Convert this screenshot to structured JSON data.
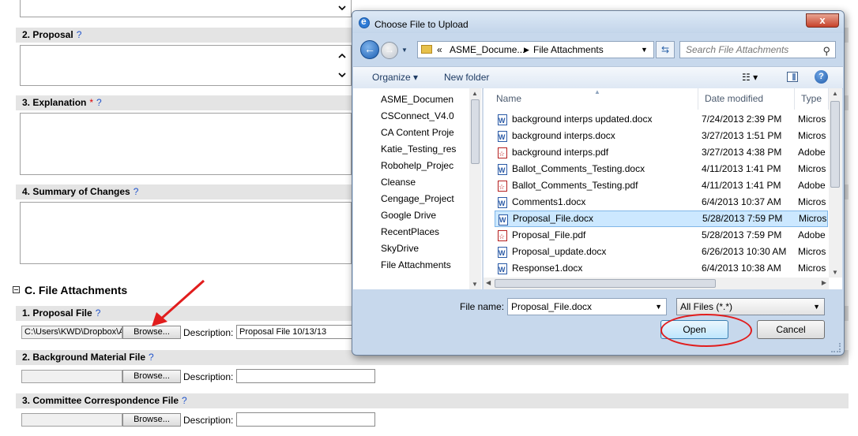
{
  "form": {
    "sections": [
      {
        "number_title": "2. Proposal",
        "required": "",
        "help": "?"
      },
      {
        "number_title": "3. Explanation",
        "required": "*",
        "help": "?"
      },
      {
        "number_title": "4. Summary of Changes",
        "help": "?"
      }
    ],
    "group_title": "C. File Attachments",
    "attachments": [
      {
        "number_title": "1. Proposal File",
        "help": "?",
        "file_path": "C:\\Users\\KWD\\Dropbox\\A",
        "browse_label": "Browse...",
        "desc_label": "Description:",
        "desc_value": "Proposal File 10/13/13"
      },
      {
        "number_title": "2. Background Material File",
        "help": "?",
        "file_path": "",
        "browse_label": "Browse...",
        "desc_label": "Description:",
        "desc_value": ""
      },
      {
        "number_title": "3. Committee Correspondence File",
        "help": "?",
        "file_path": "",
        "browse_label": "Browse...",
        "desc_label": "Description:",
        "desc_value": ""
      }
    ]
  },
  "dialog": {
    "title": "Choose File to Upload",
    "close_glyph": "x",
    "address": {
      "chevrons": "«",
      "crumbs": [
        "ASME_Docume...",
        "File Attachments"
      ],
      "separator": "▶"
    },
    "search_placeholder": "Search File Attachments",
    "toolbar": {
      "organize": "Organize ▾",
      "new_folder": "New folder",
      "view_glyph": "☷ ▾",
      "help": "?"
    },
    "nav_items": [
      {
        "label": "ASME_Documen",
        "icon": "folder-icon"
      },
      {
        "label": "CSConnect_V4.0",
        "icon": "folder-icon"
      },
      {
        "label": "CA Content Proje",
        "icon": "folder-icon"
      },
      {
        "label": "Katie_Testing_res",
        "icon": "folder-icon"
      },
      {
        "label": "Robohelp_Projec",
        "icon": "folder-icon"
      },
      {
        "label": "Cleanse",
        "icon": "folder-icon"
      },
      {
        "label": "Cengage_Project",
        "icon": "folder-icon"
      },
      {
        "label": "Google Drive",
        "icon": "google-drive-icon"
      },
      {
        "label": "RecentPlaces",
        "icon": "recent-places-icon"
      },
      {
        "label": "SkyDrive",
        "icon": "skydrive-icon"
      },
      {
        "label": "File Attachments",
        "icon": "folder-icon"
      }
    ],
    "columns": {
      "name": "Name",
      "date": "Date modified",
      "type": "Type"
    },
    "files": [
      {
        "name": "background interps updated.docx",
        "date": "7/24/2013 2:39 PM",
        "type": "Micros",
        "kind": "docx"
      },
      {
        "name": "background interps.docx",
        "date": "3/27/2013 1:51 PM",
        "type": "Micros",
        "kind": "docx"
      },
      {
        "name": "background interps.pdf",
        "date": "3/27/2013 4:38 PM",
        "type": "Adobe",
        "kind": "pdf"
      },
      {
        "name": "Ballot_Comments_Testing.docx",
        "date": "4/11/2013 1:41 PM",
        "type": "Micros",
        "kind": "docx"
      },
      {
        "name": "Ballot_Comments_Testing.pdf",
        "date": "4/11/2013 1:41 PM",
        "type": "Adobe",
        "kind": "pdf"
      },
      {
        "name": "Comments1.docx",
        "date": "6/4/2013 10:37 AM",
        "type": "Micros",
        "kind": "docx"
      },
      {
        "name": "Proposal_File.docx",
        "date": "5/28/2013 7:59 PM",
        "type": "Micros",
        "kind": "docx",
        "selected": true
      },
      {
        "name": "Proposal_File.pdf",
        "date": "5/28/2013 7:59 PM",
        "type": "Adobe",
        "kind": "pdf"
      },
      {
        "name": "Proposal_update.docx",
        "date": "6/26/2013 10:30 AM",
        "type": "Micros",
        "kind": "docx"
      },
      {
        "name": "Response1.docx",
        "date": "6/4/2013 10:38 AM",
        "type": "Micros",
        "kind": "docx"
      }
    ],
    "file_name_label": "File name:",
    "file_name_value": "Proposal_File.docx",
    "filter_value": "All Files (*.*)",
    "open_label": "Open",
    "cancel_label": "Cancel"
  },
  "colors": {
    "annotation": "#e11d1d",
    "selection": "#cce8ff",
    "help_link": "#2255cc"
  }
}
